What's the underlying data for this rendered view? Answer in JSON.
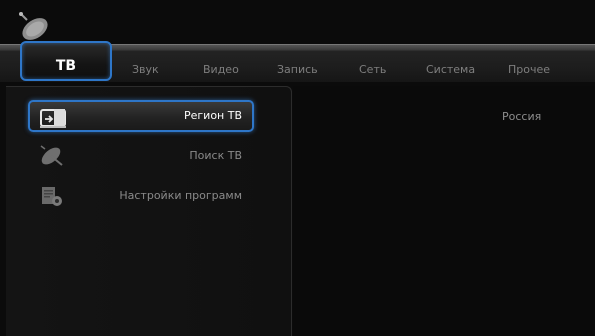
{
  "tabs": [
    {
      "label": "ТВ",
      "active": true
    },
    {
      "label": "Звук"
    },
    {
      "label": "Видео"
    },
    {
      "label": "Запись"
    },
    {
      "label": "Сеть"
    },
    {
      "label": "Система"
    },
    {
      "label": "Прочее"
    }
  ],
  "menu": [
    {
      "label": "Регион ТВ",
      "icon": "tv-region-icon",
      "selected": true
    },
    {
      "label": "Поиск ТВ",
      "icon": "satellite-dish-icon"
    },
    {
      "label": "Настройки программ",
      "icon": "program-settings-icon"
    }
  ],
  "value": "Россия",
  "colors": {
    "accent": "#2e76c8",
    "background": "#0b0b0b"
  }
}
